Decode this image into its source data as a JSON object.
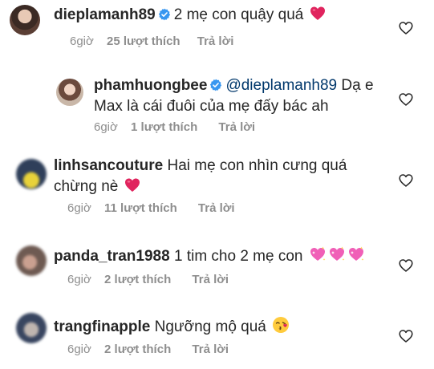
{
  "comments": [
    {
      "username": "dieplamanh89",
      "verified": true,
      "text": "2 mẹ con quậy quá",
      "emojis": [
        "red-heart-emoji"
      ],
      "time": "6giờ",
      "likes": "25 lượt thích",
      "reply": "Trả lời"
    },
    {
      "username": "phamhuongbee",
      "verified": true,
      "mention": "@dieplamanh89",
      "text_line1": "Dạ e",
      "text_line2": "Max là cái đuôi của mẹ đấy bác ah",
      "time": "6giờ",
      "likes": "1 lượt thích",
      "reply": "Trả lời"
    },
    {
      "username": "linhsancouture",
      "verified": false,
      "text_line1": "Hai mẹ con nhìn cưng quá",
      "text_line2": "chừng nè",
      "emojis": [
        "red-heart-emoji"
      ],
      "time": "6giờ",
      "likes": "11 lượt thích",
      "reply": "Trả lời"
    },
    {
      "username": "panda_tran1988",
      "verified": false,
      "text": "1 tim cho 2 mẹ con",
      "emojis": [
        "sparkling-heart-emoji",
        "sparkling-heart-emoji",
        "sparkling-heart-emoji"
      ],
      "time": "6giờ",
      "likes": "2 lượt thích",
      "reply": "Trả lời"
    },
    {
      "username": "trangfinapple",
      "verified": false,
      "text": "Ngưỡng mộ quá",
      "emojis": [
        "face-blowing-kiss-emoji"
      ],
      "time": "6giờ",
      "likes": "2 lượt thích",
      "reply": "Trả lời"
    }
  ],
  "colors": {
    "text": "#262626",
    "meta": "#8e8e8e",
    "mention": "#00376b",
    "verified": "#3897f0",
    "heart": "#ed4956"
  }
}
